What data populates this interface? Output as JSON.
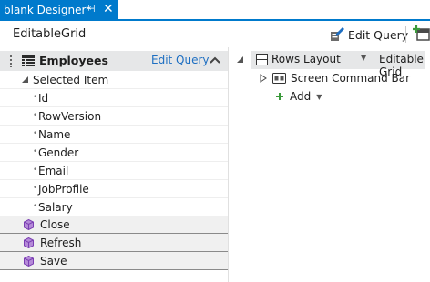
{
  "tab": {
    "title": "blank Designer*",
    "pin_glyph": "⊣",
    "close_glyph": "✕"
  },
  "toolbar": {
    "screen_name": "EditableGrid",
    "edit_query_label": "Edit Query"
  },
  "left": {
    "header": {
      "title": "Employees",
      "edit_query": "Edit Query"
    },
    "selected_item": "Selected Item",
    "properties": [
      "Id",
      "RowVersion",
      "Name",
      "Gender",
      "Email",
      "JobProfile",
      "Salary"
    ],
    "commands": [
      "Close",
      "Refresh",
      "Save"
    ]
  },
  "right": {
    "layout_label": "Rows Layout",
    "control_label": "Editable Grid",
    "command_bar": "Screen Command Bar",
    "add_label": "Add"
  },
  "colors": {
    "accent": "#007acc",
    "link": "#1e6fc2",
    "header_bg": "#e6e7e8",
    "cube": "#7b3fb3",
    "add_green": "#3a9a3a"
  },
  "icons": [
    "pin-icon",
    "close-icon",
    "edit-query-icon",
    "add-data-item-icon",
    "grid-icon",
    "chevron-up-icon",
    "expand-triangle-icon",
    "cube-icon",
    "rows-layout-icon",
    "command-bar-icon",
    "plus-icon",
    "dropdown-caret-icon"
  ]
}
